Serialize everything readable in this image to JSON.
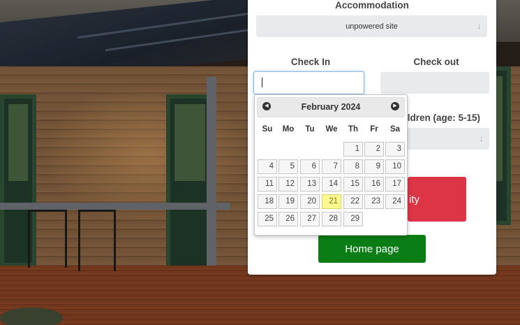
{
  "form": {
    "accommodation_label": "Accommodation",
    "accommodation_value": "unpowered site",
    "checkin_label": "Check In",
    "checkout_label": "Check out",
    "children_label": "ildren (age: 5-15)",
    "availability_btn": "ity",
    "home_btn": "Home page"
  },
  "datepicker": {
    "title": "February 2024",
    "prev": "◀",
    "next": "▶",
    "weekdays": [
      "Su",
      "Mo",
      "Tu",
      "We",
      "Th",
      "Fr",
      "Sa"
    ],
    "days": [
      "1",
      "2",
      "3",
      "4",
      "5",
      "6",
      "7",
      "8",
      "9",
      "10",
      "11",
      "12",
      "13",
      "14",
      "15",
      "16",
      "17",
      "18",
      "19",
      "20",
      "21",
      "22",
      "23",
      "24",
      "25",
      "26",
      "27",
      "28",
      "29"
    ],
    "first_weekday": 4,
    "highlighted_day": "21"
  },
  "colors": {
    "primary_red": "#dc3545",
    "primary_green": "#0a7d14",
    "today_highlight": "#fffa90"
  }
}
